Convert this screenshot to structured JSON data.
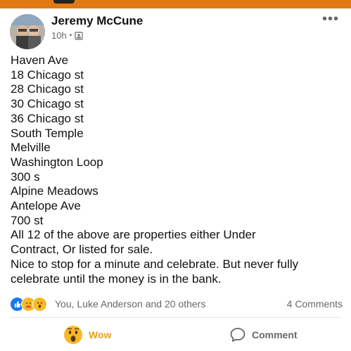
{
  "post": {
    "author": "Jeremy McCune",
    "time": "10h",
    "lines": [
      "Haven Ave",
      "18 Chicago st",
      "28 Chicago st",
      "30 Chicago st",
      "36 Chicago st",
      "South Temple",
      "Melville",
      "Washington Loop",
      "300 s",
      "Alpine Meadows",
      "Antelope Ave",
      "700 st",
      "All 12 of the above are properties either Under",
      "Contract, Or listed for sale.",
      "Nice to stop for a minute and celebrate. But never fully",
      "celebrate until the money is in the bank."
    ]
  },
  "engagement": {
    "reactions_text": "You, Luke Anderson and 20 others",
    "comments_text": "4 Comments"
  },
  "actions": {
    "wow_label": "Wow",
    "comment_label": "Comment"
  },
  "colors": {
    "status_bar": "#e07a14",
    "like_blue": "#1877f2",
    "wow_yellow": "#f7b928",
    "muted_text": "#65676b"
  }
}
